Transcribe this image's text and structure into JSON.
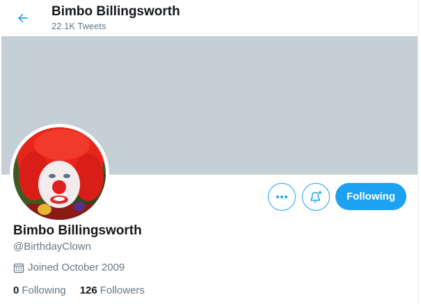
{
  "header": {
    "title": "Bimbo Billingsworth",
    "tweet_count": "22.1K Tweets"
  },
  "icons": {
    "back": "back-arrow-icon",
    "more": "more-dots-icon",
    "notify": "bell-plus-icon",
    "calendar": "calendar-icon"
  },
  "colors": {
    "accent": "#1da1f2",
    "banner": "#c4cfd6"
  },
  "profile": {
    "display_name": "Bimbo Billingsworth",
    "handle": "@BirthdayClown",
    "joined": "Joined October 2009",
    "avatar_alt": "clown-photo"
  },
  "actions": {
    "follow_label": "Following"
  },
  "stats": {
    "following_count": "0",
    "following_label": "Following",
    "followers_count": "126",
    "followers_label": "Followers"
  }
}
